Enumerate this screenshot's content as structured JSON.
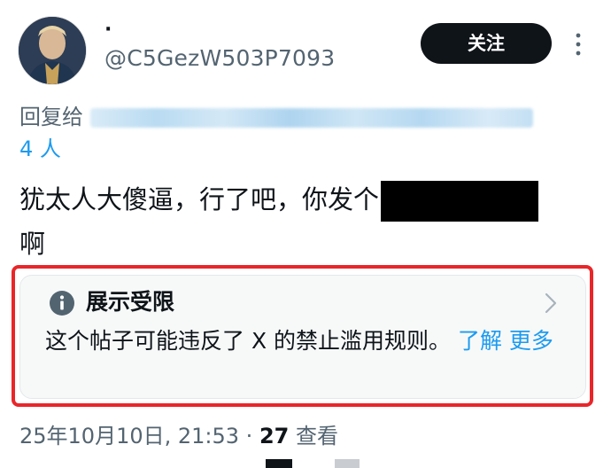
{
  "author": {
    "display_name": "·",
    "handle": "@C5GezW503P7093",
    "avatar_icon": "avatar-icon"
  },
  "header": {
    "follow_label": "关注",
    "more_icon": "more-vertical-icon"
  },
  "reply": {
    "prefix": "回复给",
    "count_label": "4 人"
  },
  "tweet": {
    "line1": "犹太人大傻逼，行了吧，你发个",
    "line2": "啊"
  },
  "notice": {
    "title": "展示受限",
    "body": "这个帖子可能违反了 X 的禁止滥用规则。",
    "learn_more": "了解 更多",
    "icon": "info-icon",
    "chevron": "chevron-right-icon"
  },
  "meta": {
    "timestamp": "25年10月10日, 21:53 · ",
    "view_count": "27",
    "view_label": " 查看"
  },
  "colors": {
    "accent": "#1d9bf0",
    "text": "#0f1419",
    "muted": "#536471",
    "highlight": "#e8262a",
    "button_bg": "#0f1419"
  }
}
